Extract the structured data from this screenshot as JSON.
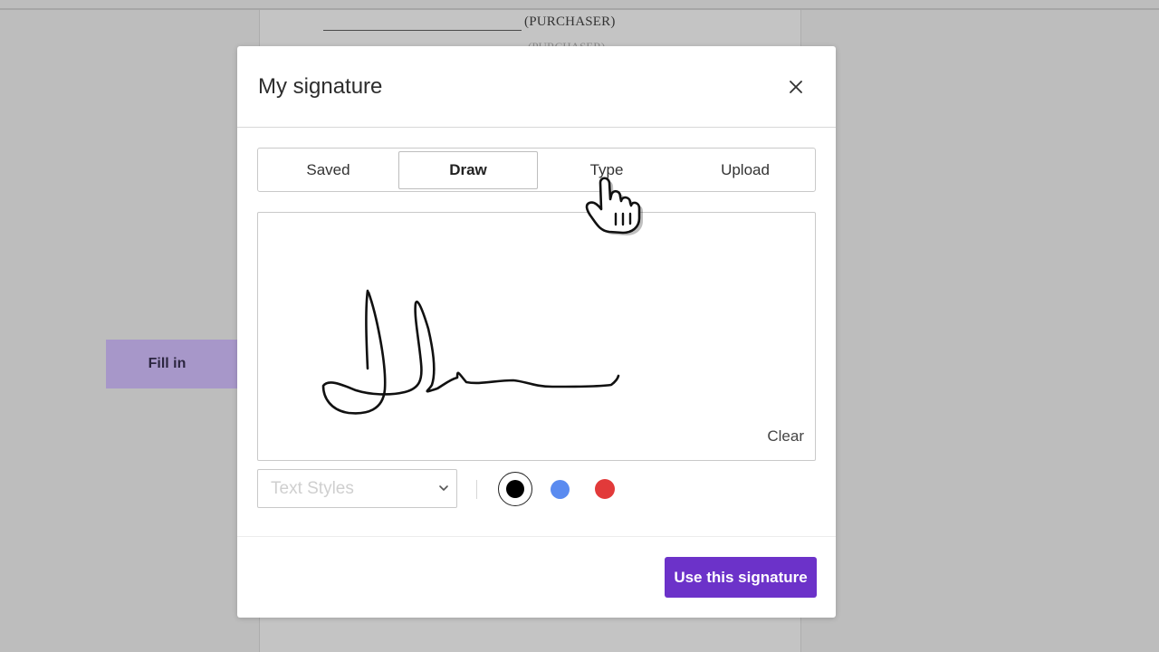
{
  "document": {
    "purchaser_label": "(PURCHASER)",
    "purchaser_ghost": "(PURCHASER)"
  },
  "fill_in": {
    "label": "Fill in"
  },
  "modal": {
    "title": "My signature",
    "close_icon": "close-icon",
    "tabs": [
      {
        "label": "Saved"
      },
      {
        "label": "Draw",
        "active": true
      },
      {
        "label": "Type"
      },
      {
        "label": "Upload"
      }
    ],
    "canvas": {
      "clear_label": "Clear"
    },
    "text_styles": {
      "placeholder": "Text Styles"
    },
    "colors": [
      {
        "name": "black",
        "hex": "#000000",
        "selected": true
      },
      {
        "name": "blue",
        "hex": "#5a8bf0"
      },
      {
        "name": "red",
        "hex": "#e23a3a"
      }
    ],
    "use_button": "Use this signature"
  },
  "theme": {
    "accent": "#6c32c9",
    "fill_in_bg": "#a797c9",
    "backdrop": "#bdbdbd"
  }
}
